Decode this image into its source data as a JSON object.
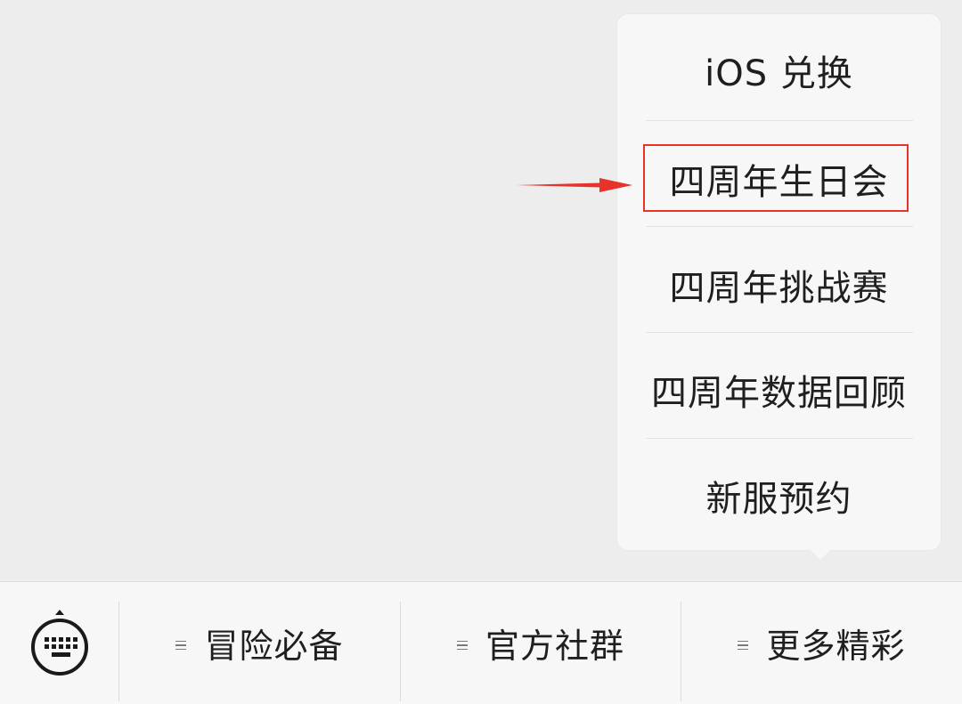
{
  "submenu": {
    "items": [
      {
        "label": "iOS 兑换"
      },
      {
        "label": "四周年生日会"
      },
      {
        "label": "四周年挑战赛"
      },
      {
        "label": "四周年数据回顾"
      },
      {
        "label": "新服预约"
      }
    ]
  },
  "bottom_menu": {
    "tabs": [
      {
        "label": "冒险必备"
      },
      {
        "label": "官方社群"
      },
      {
        "label": "更多精彩"
      }
    ]
  },
  "annotation": {
    "highlight_color": "#e8332a"
  }
}
